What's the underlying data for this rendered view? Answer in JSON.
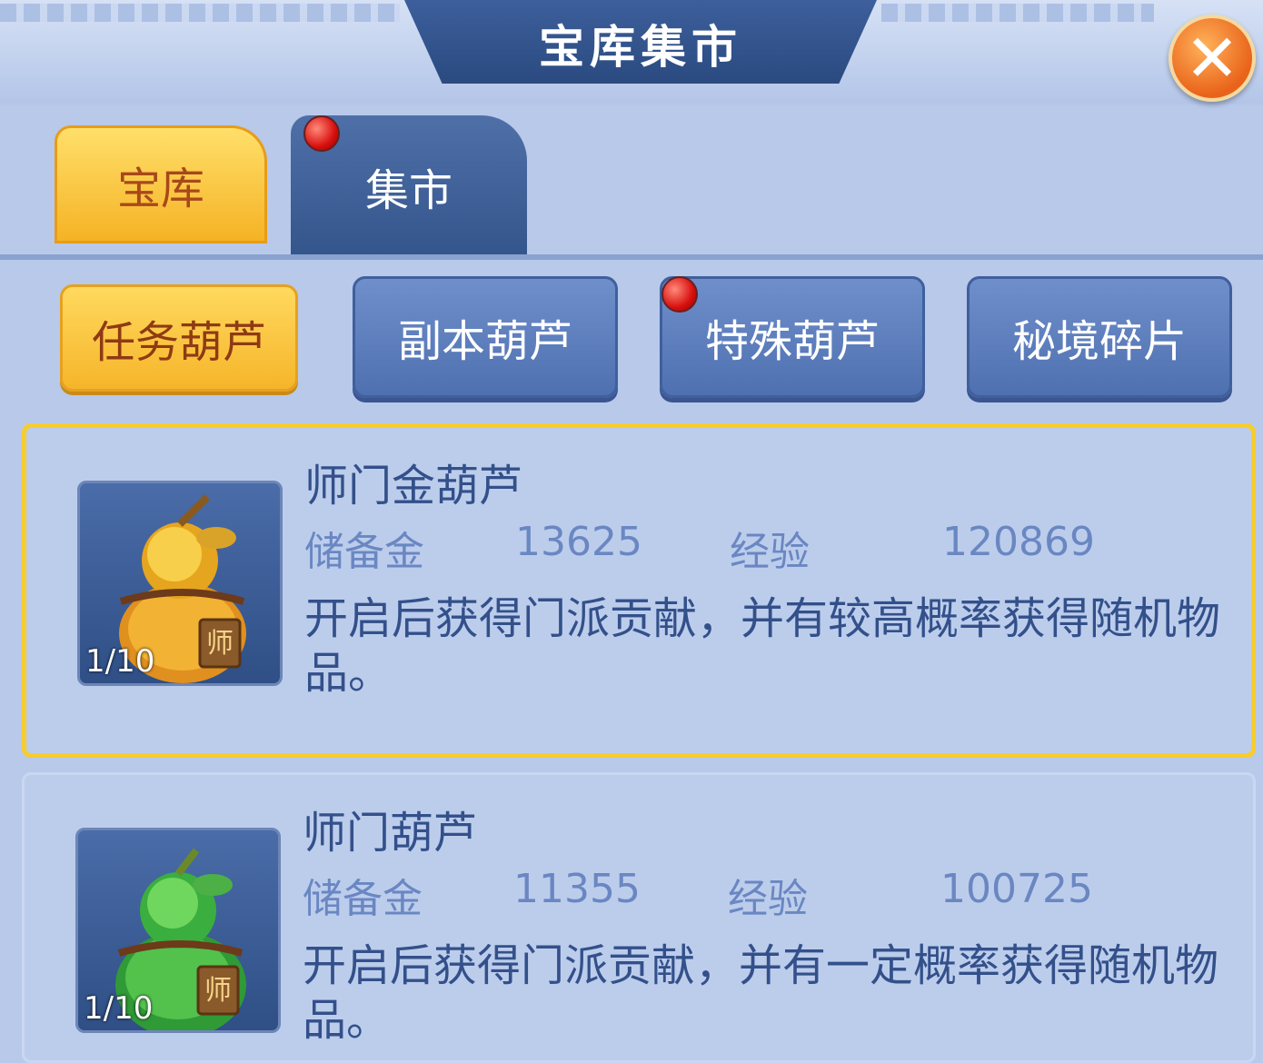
{
  "header": {
    "title": "宝库集市"
  },
  "tabs": [
    {
      "label": "宝库",
      "active": true
    },
    {
      "label": "集市",
      "active": false,
      "has_notification": true
    }
  ],
  "subtabs": [
    {
      "label": "任务葫芦",
      "active": true
    },
    {
      "label": "副本葫芦",
      "active": false
    },
    {
      "label": "特殊葫芦",
      "active": false,
      "has_notification": true
    },
    {
      "label": "秘境碎片",
      "active": false
    }
  ],
  "items": [
    {
      "name": "师门金葫芦",
      "count": "1/10",
      "reserve_label": "储备金",
      "reserve_value": "13625",
      "exp_label": "经验",
      "exp_value": "120869",
      "description": "开启后获得门派贡献，并有较高概率获得随机物品。",
      "icon": "gold-gourd-icon",
      "selected": true
    },
    {
      "name": "师门葫芦",
      "count": "1/10",
      "reserve_label": "储备金",
      "reserve_value": "11355",
      "exp_label": "经验",
      "exp_value": "100725",
      "description": "开启后获得门派贡献，并有一定概率获得随机物品。",
      "icon": "green-gourd-icon",
      "selected": false
    }
  ],
  "colors": {
    "accent_gold": "#f7cc2e",
    "panel_blue": "#bccdec",
    "text_blue": "#33508a"
  }
}
